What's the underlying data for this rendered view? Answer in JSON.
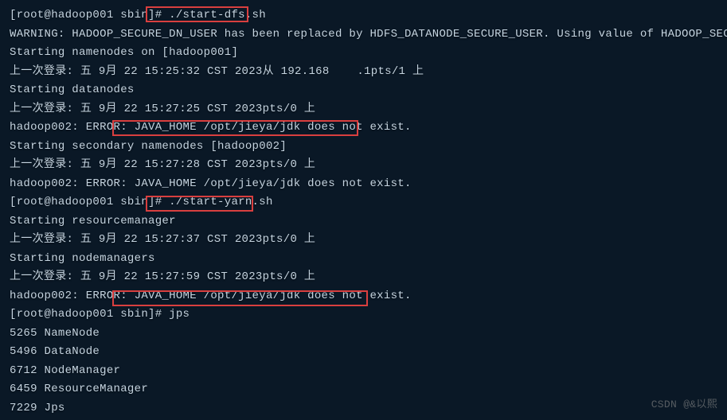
{
  "lines": {
    "l0": "[root@hadoop001 sbin]# ./start-dfs.sh",
    "l1": "WARNING: HADOOP_SECURE_DN_USER has been replaced by HDFS_DATANODE_SECURE_USER. Using value of HADOOP_SECURE_DN_USER.",
    "l2": "Starting namenodes on [hadoop001]",
    "l3": "上一次登录: 五 9月 22 15:25:32 CST 2023从 192.168    .1pts/1 上",
    "l4": "Starting datanodes",
    "l5": "上一次登录: 五 9月 22 15:27:25 CST 2023pts/0 上",
    "l6": "hadoop002: ERROR: JAVA_HOME /opt/jieya/jdk does not exist.",
    "l7": "Starting secondary namenodes [hadoop002]",
    "l8": "上一次登录: 五 9月 22 15:27:28 CST 2023pts/0 上",
    "l9": "hadoop002: ERROR: JAVA_HOME /opt/jieya/jdk does not exist.",
    "l10": "[root@hadoop001 sbin]# ./start-yarn.sh",
    "l11": "Starting resourcemanager",
    "l12": "上一次登录: 五 9月 22 15:27:37 CST 2023pts/0 上",
    "l13": "Starting nodemanagers",
    "l14": "上一次登录: 五 9月 22 15:27:59 CST 2023pts/0 上",
    "l15": "hadoop002: ERROR: JAVA_HOME /opt/jieya/jdk does not exist.",
    "l16": "[root@hadoop001 sbin]# jps",
    "l17": "5265 NameNode",
    "l18": "5496 DataNode",
    "l19": "6712 NodeManager",
    "l20": "6459 ResourceManager",
    "l21": "7229 Jps"
  },
  "watermark": "CSDN @&以熙",
  "highlights": {
    "cmd1": "./start-dfs.sh",
    "err1": "JAVA_HOME /opt/jieya/jdk does not exist.",
    "cmd2": "./start-yarn.sh",
    "err2": "JAVA_HOME /opt/jieya/jdk does not exist."
  },
  "colors": {
    "bg": "#0a1826",
    "fg": "#c5d4e0",
    "highlight_border": "#d93f3f"
  }
}
